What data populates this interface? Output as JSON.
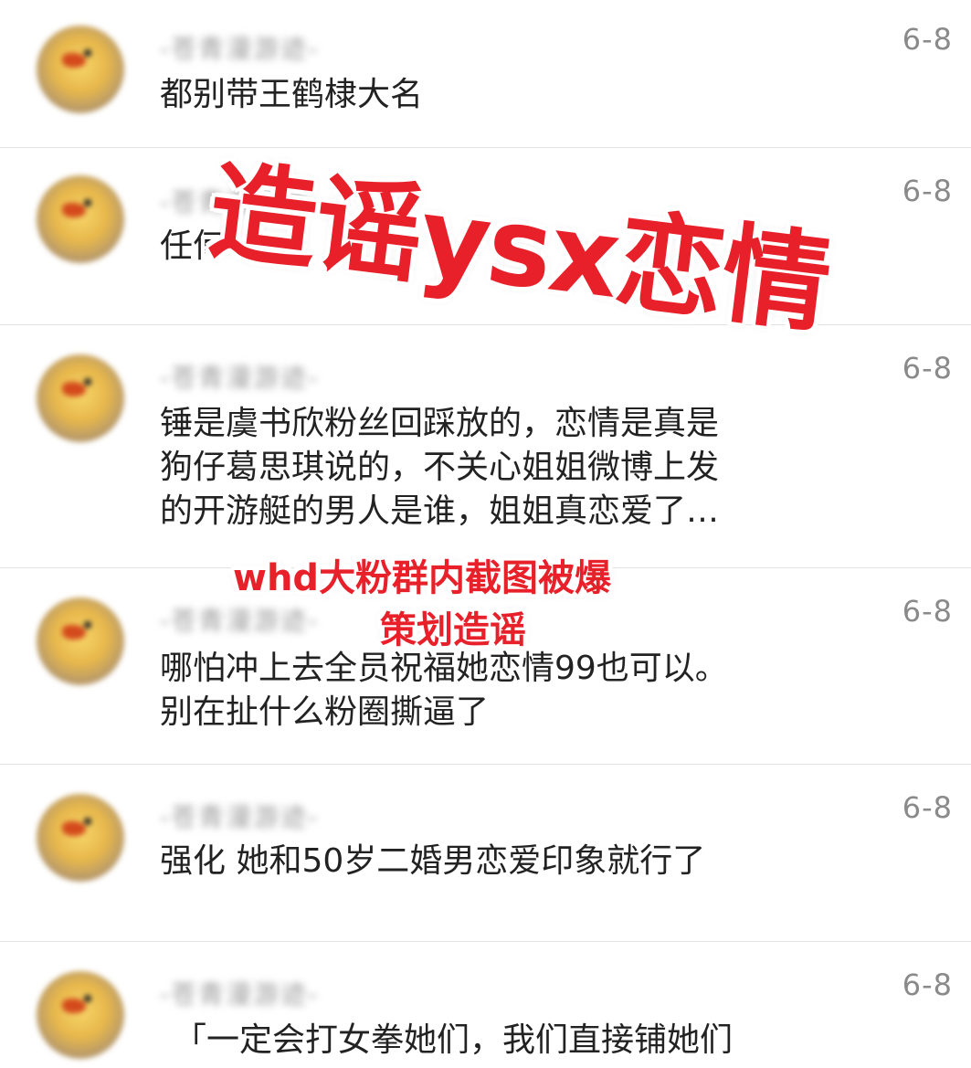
{
  "comments": [
    {
      "user": "-苍青漫游迹-",
      "date": "6-8",
      "text": "都别带王鹤棣大名"
    },
    {
      "user": "-苍青漫游迹-",
      "date": "6-8",
      "text": "任何"
    },
    {
      "user": "-苍青漫游迹-",
      "date": "6-8",
      "text": "锤是虞书欣粉丝回踩放的，恋情是真是\n狗仔葛思琪说的，不关心姐姐微博上发\n的开游艇的男人是谁，姐姐真恋爱了…"
    },
    {
      "user": "-苍青漫游迹-",
      "date": "6-8",
      "text": "哪怕冲上去全员祝福她恋情99也可以。\n别在扯什么粉圈撕逼了"
    },
    {
      "user": "-苍青漫游迹-",
      "date": "6-8",
      "text": "强化 她和50岁二婚男恋爱印象就行了"
    },
    {
      "user": "-苍青漫游迹-",
      "date": "6-8",
      "text": "「一定会打女拳她们，我们直接铺她们"
    }
  ],
  "overlays": {
    "big_stamp": "造谣ysx恋情",
    "small_stamp_line1": "whd大粉群内截图被爆",
    "small_stamp_line2": "策划造谣",
    "stamp_color": "#e8202a"
  },
  "icons": {
    "avatar": "duck-avatar-icon"
  }
}
